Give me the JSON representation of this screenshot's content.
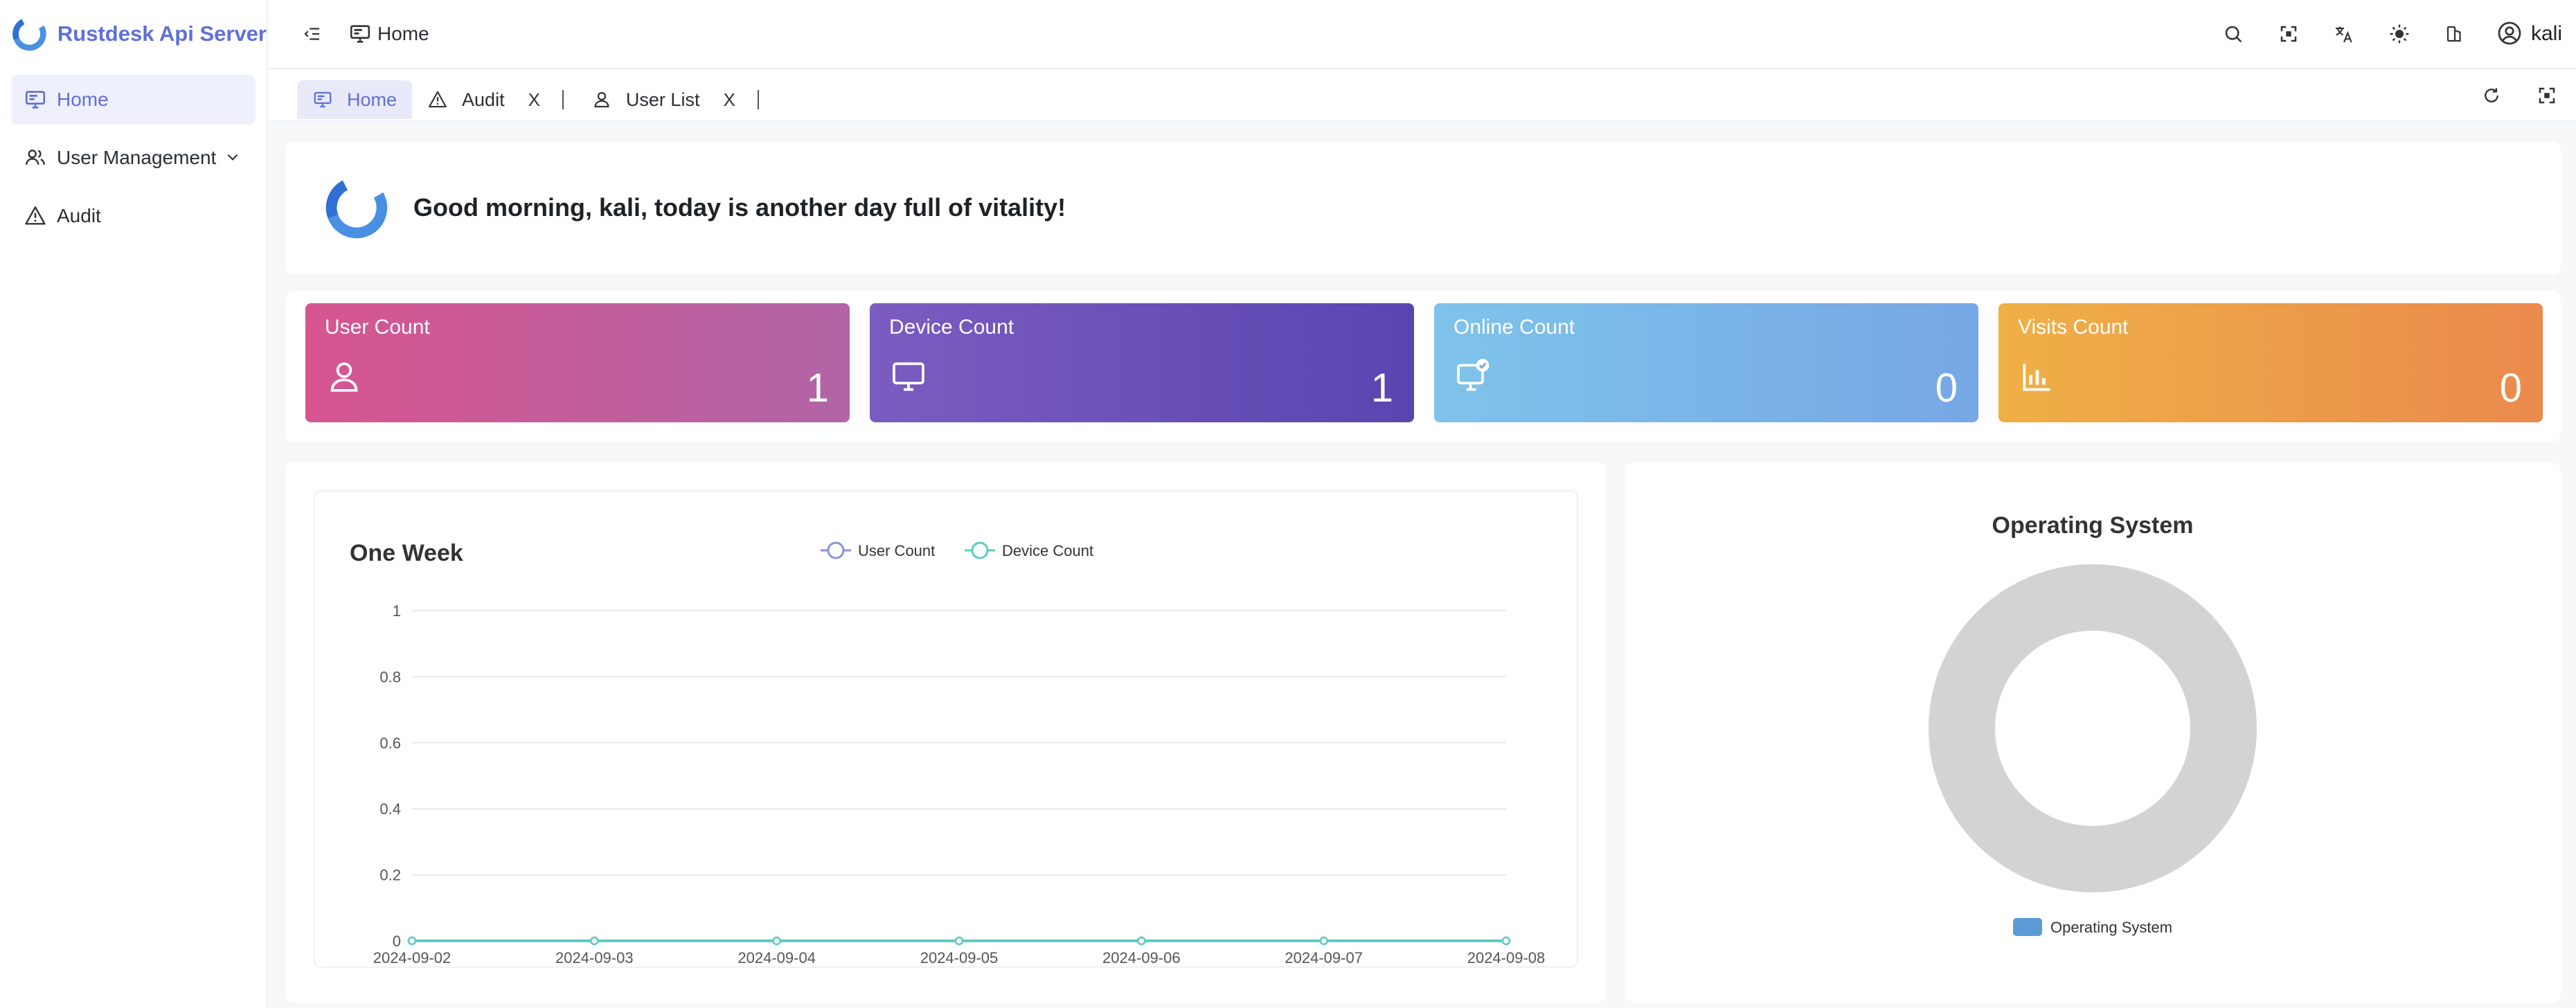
{
  "app": {
    "title": "Rustdesk Api Server"
  },
  "sidebar": {
    "items": [
      {
        "label": "Home",
        "icon": "monitor-icon",
        "active": true
      },
      {
        "label": "User Management",
        "icon": "users-icon",
        "expandable": true
      },
      {
        "label": "Audit",
        "icon": "warning-icon"
      }
    ]
  },
  "header": {
    "breadcrumb": "Home",
    "user_name": "kali",
    "icons": [
      "search-icon",
      "fullscreen-icon",
      "translate-icon",
      "theme-icon",
      "layout-icon",
      "user-circle-icon"
    ]
  },
  "tabs": [
    {
      "label": "Home",
      "active": true,
      "closable": false
    },
    {
      "label": "Audit",
      "active": false,
      "closable": true,
      "close_glyph": "X"
    },
    {
      "label": "User List",
      "active": false,
      "closable": true,
      "close_glyph": "X"
    }
  ],
  "greeting": {
    "text": "Good morning, kali, today is another day full of vitality!"
  },
  "stats": [
    {
      "label": "User Count",
      "value": "1",
      "icon": "user-icon",
      "color_from": "#d65590",
      "color_to": "#b165a6"
    },
    {
      "label": "Device Count",
      "value": "1",
      "icon": "monitor-icon",
      "color_from": "#7b5cc1",
      "color_to": "#5a45b0"
    },
    {
      "label": "Online Count",
      "value": "0",
      "icon": "monitor-check-icon",
      "color_from": "#7ec3ea",
      "color_to": "#77a7e6"
    },
    {
      "label": "Visits Count",
      "value": "0",
      "icon": "bar-chart-icon",
      "color_from": "#efb046",
      "color_to": "#ea8a4d"
    }
  ],
  "chart_data": [
    {
      "type": "line",
      "title": "One Week",
      "x": [
        "2024-09-02",
        "2024-09-03",
        "2024-09-04",
        "2024-09-05",
        "2024-09-06",
        "2024-09-07",
        "2024-09-08"
      ],
      "ylim": [
        0,
        1
      ],
      "yticks": [
        "0",
        "0.2",
        "0.4",
        "0.6",
        "0.8",
        "1"
      ],
      "series": [
        {
          "name": "User Count",
          "values": [
            0,
            0,
            0,
            0,
            0,
            0,
            0
          ],
          "color": "#8b93d6"
        },
        {
          "name": "Device Count",
          "values": [
            0,
            0,
            0,
            0,
            0,
            0,
            0
          ],
          "color": "#5ccbc6"
        }
      ],
      "grid": true,
      "legend": "top-center"
    },
    {
      "type": "pie",
      "title": "Operating System",
      "slices": [],
      "legend_entries": [
        "Operating System"
      ],
      "legend": "bottom-center",
      "empty_ring_color": "#d3d3d3",
      "legend_color": "#5b9bd5"
    }
  ]
}
